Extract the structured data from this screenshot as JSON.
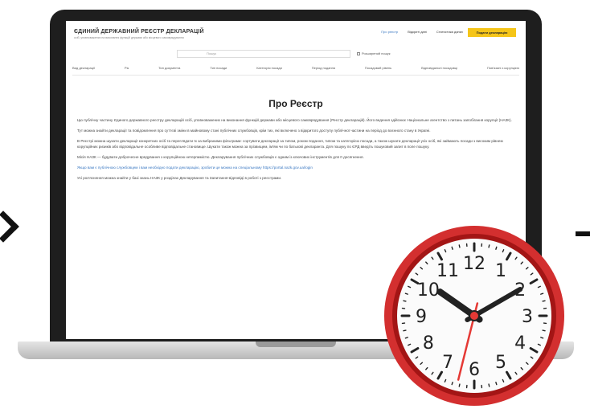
{
  "site": {
    "title": "ЄДИНИЙ ДЕРЖАВНИЙ РЕЄСТР ДЕКЛАРАЦІЙ",
    "subtitle": "осіб, уповноважених на виконання функцій держави або місцевого самоврядування",
    "top_links": [
      "Про реєстр",
      "Відкриті дані",
      "Статистика даних"
    ],
    "declare_button": "Подати декларацію",
    "search_placeholder": "Пошук",
    "extended_search": "Розширений пошук",
    "filters": [
      "Вид декларації",
      "Рік",
      "Тип документа",
      "Тип посади",
      "Категорія посади",
      "Період подання",
      "Посадовий рівень",
      "Відповідальні посадовці",
      "Пов'язані з корупцією"
    ]
  },
  "page": {
    "title": "Про Реєстр",
    "paragraphs": [
      "Цю публічну частину Єдиного державного реєстру декларацій осіб, уповноважених на виконання функцій держави або місцевого самоврядування (Реєстр декларацій). Його ведення здійснює Національне агентство з питань запобігання корупції (НАЗК).",
      "Тут можна знайти декларації та повідомлення про суттєві зміни в майновому стані публічних службовців, крім тих, які включено з відкритого доступу публічної частини на період до воєнного стану в Україні.",
      "В Реєстрі можна шукати декларації конкретних осіб та переглядати їх за вибраними фільтрами: сортувати декларації за типом, роком подання, типом та категорією посади, а також шукати декларації усіх осіб, які займають посади з високим рівнем корупційних ризиків або відповідальне особливе відповідальне становище. Шукати також можна за прізвищем, ім'ям чи по батькові декларанта. Для пошуку по ЄРД введіть пошуковий запит в поле пошуку.",
      "Місія НАЗК — будувати доброчесне врядування з корупційною нетерпимістю. Декларування публічних службовців є одним із ключових інструментів для її досягнення.",
      "Якщо вам є публічною службовцем і вам необхідно подати декларацію, зробити це можна на спеціальному https://portal.nazk.gov.ua/login",
      "Усі роз'яснення можна знайти у базі знань НАЗК у розділах Декларування та Запитання-відповіді в роботі з реєстрами."
    ]
  },
  "clock": {
    "numbers": [
      "12",
      "1",
      "2",
      "3",
      "4",
      "5",
      "6",
      "7",
      "8",
      "9",
      "10",
      "11"
    ],
    "colors": {
      "rim": "#d32f2f",
      "rim_dark": "#a31515",
      "face": "#fbfbfb",
      "hands": "#222222",
      "second_hand": "#e53935"
    },
    "time": "10:10"
  }
}
